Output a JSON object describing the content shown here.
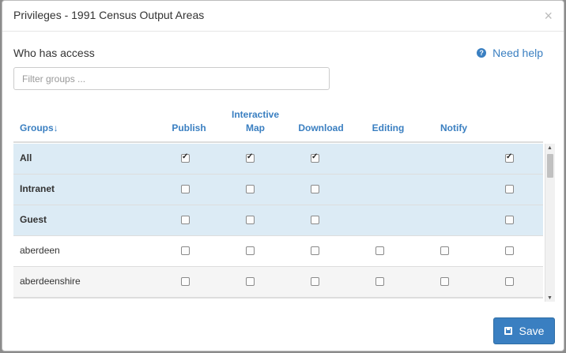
{
  "modal": {
    "title": "Privileges - 1991 Census Output Areas",
    "close_label": "×",
    "who_label": "Who has access",
    "help_label": "Need help",
    "filter_placeholder": "Filter groups ...",
    "save_label": "Save"
  },
  "table": {
    "headers": {
      "groups": "Groups↓",
      "publish": "Publish",
      "interactive_1": "Interactive",
      "interactive_2": "Map",
      "download": "Download",
      "editing": "Editing",
      "notify": "Notify"
    },
    "rows": [
      {
        "name": "All",
        "publish": true,
        "map": true,
        "download": true,
        "editing": null,
        "notify": null,
        "last": true
      },
      {
        "name": "Intranet",
        "publish": false,
        "map": false,
        "download": false,
        "editing": null,
        "notify": null,
        "last": false
      },
      {
        "name": "Guest",
        "publish": false,
        "map": false,
        "download": false,
        "editing": null,
        "notify": null,
        "last": false
      },
      {
        "name": "aberdeen",
        "publish": false,
        "map": false,
        "download": false,
        "editing": false,
        "notify": false,
        "last": false
      },
      {
        "name": "aberdeenshire",
        "publish": false,
        "map": false,
        "download": false,
        "editing": false,
        "notify": false,
        "last": false
      }
    ]
  },
  "colors": {
    "accent": "#3a7fc1",
    "selected_row": "#dcebf5"
  }
}
